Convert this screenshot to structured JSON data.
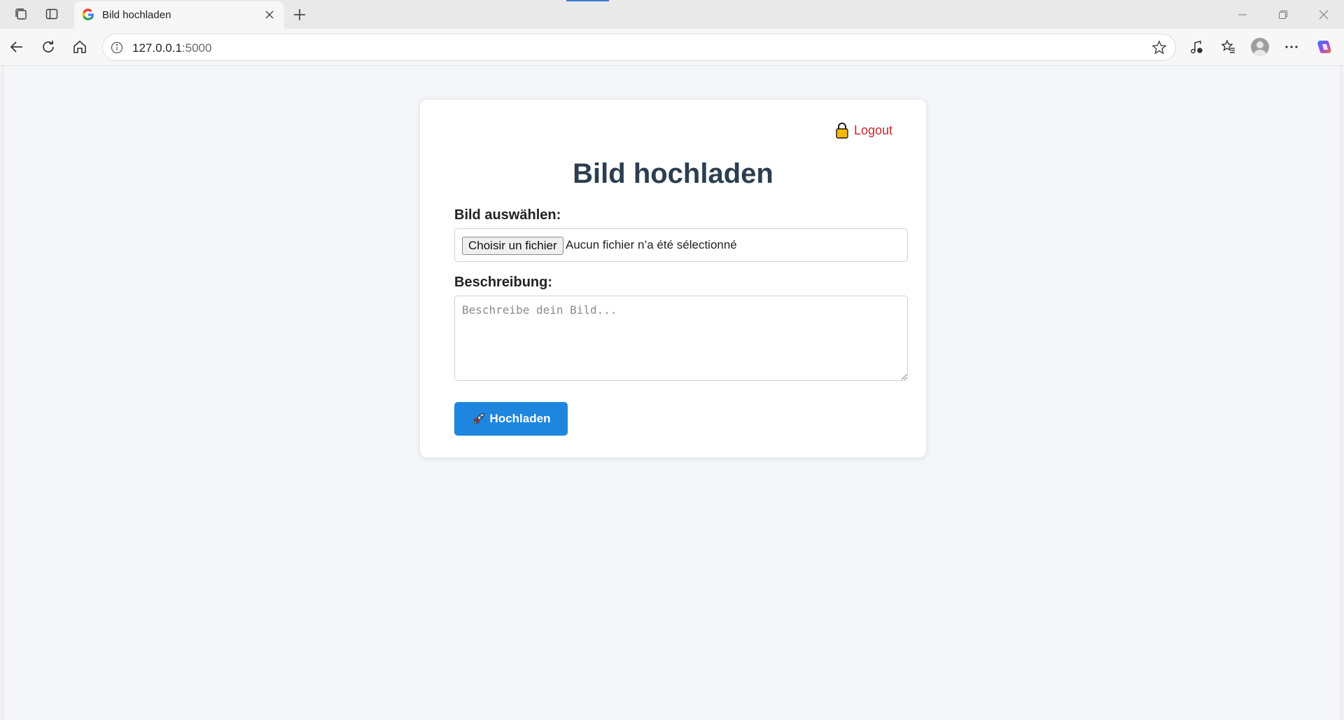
{
  "browser": {
    "tab_title": "Bild hochladen",
    "url_host": "127.0.0.1",
    "url_port": ":5000",
    "icons": [
      "workspaces-icon",
      "vertical-tabs-icon",
      "google-favicon",
      "close-icon",
      "new-tab-icon",
      "minimize-icon",
      "restore-icon",
      "close-window-icon",
      "back-icon",
      "refresh-icon",
      "home-icon",
      "site-info-icon",
      "favorite-star-icon",
      "media-control-icon",
      "favorites-icon",
      "profile-avatar",
      "more-icon",
      "copilot-icon"
    ]
  },
  "page": {
    "logout_label": "Logout",
    "logout_icon": "lock-icon",
    "title": "Bild hochladen",
    "image_label": "Bild auswählen:",
    "file_button_label": "Choisir un fichier",
    "file_status": "Aucun fichier n’a été sélectionné",
    "description_label": "Beschreibung:",
    "description_placeholder": "Beschreibe dein Bild...",
    "upload_button_label": "Hochladen",
    "upload_icon": "rocket-icon"
  },
  "colors": {
    "accent": "#1f86e0",
    "logout": "#c0282d",
    "title": "#2c3e50",
    "background": "#f4f6f9"
  }
}
